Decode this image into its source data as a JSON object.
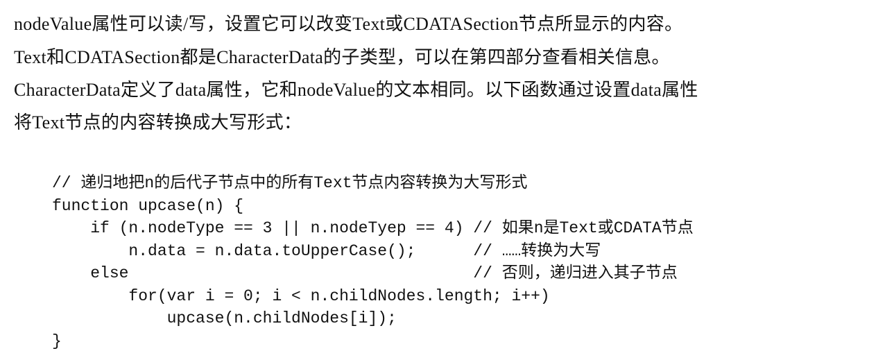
{
  "paragraph": [
    "nodeValue属性可以读/写，设置它可以改变Text或CDATASection节点所显示的内容。",
    "Text和CDATASection都是CharacterData的子类型，可以在第四部分查看相关信息。",
    "CharacterData定义了data属性，它和nodeValue的文本相同。以下函数通过设置data属性",
    "将Text节点的内容转换成大写形式："
  ],
  "code": [
    "// 递归地把n的后代子节点中的所有Text节点内容转换为大写形式",
    "function upcase(n) {",
    "    if (n.nodeType == 3 || n.nodeTyep == 4) // 如果n是Text或CDATA节点",
    "        n.data = n.data.toUpperCase();      // ……转换为大写",
    "    else                                    // 否则，递归进入其子节点",
    "        for(var i = 0; i < n.childNodes.length; i++)",
    "            upcase(n.childNodes[i]);",
    "}"
  ]
}
